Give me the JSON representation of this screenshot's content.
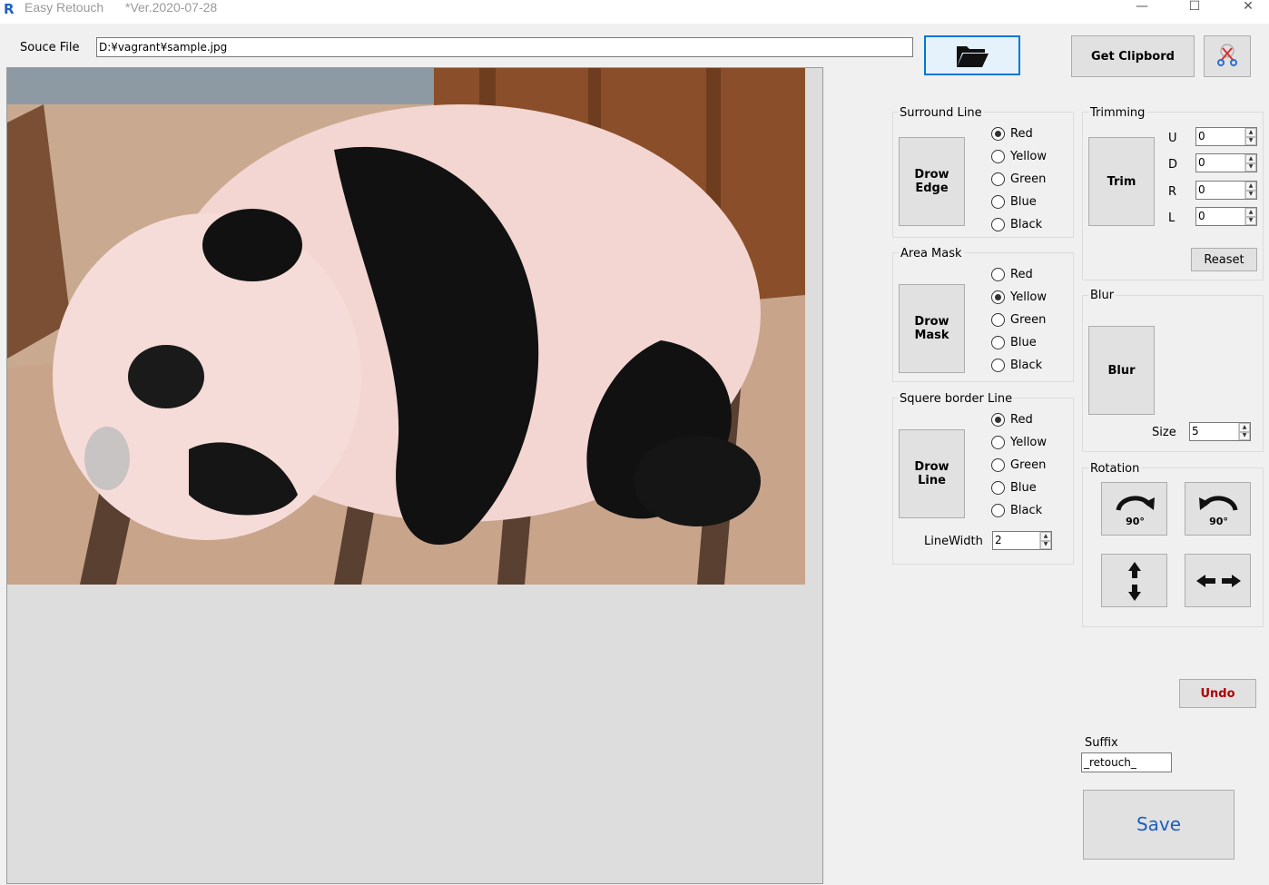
{
  "window": {
    "title": "Easy Retouch",
    "version": "*Ver.2020-07-28",
    "logo": "R",
    "minimize": "—",
    "maximize": "☐",
    "close": "✕"
  },
  "source": {
    "label": "Souce File",
    "path": "D:¥vagrant¥sample.jpg"
  },
  "toolbar": {
    "get_clipboard": "Get Clipbord"
  },
  "surround_line": {
    "title": "Surround Line",
    "button": [
      "Drow",
      "Edge"
    ],
    "options": [
      "Red",
      "Yellow",
      "Green",
      "Blue",
      "Black"
    ],
    "selected": "Red"
  },
  "area_mask": {
    "title": "Area Mask",
    "button": [
      "Drow",
      "Mask"
    ],
    "options": [
      "Red",
      "Yellow",
      "Green",
      "Blue",
      "Black"
    ],
    "selected": "Yellow"
  },
  "square_border": {
    "title": "Squere border Line",
    "button": [
      "Drow",
      "Line"
    ],
    "options": [
      "Red",
      "Yellow",
      "Green",
      "Blue",
      "Black"
    ],
    "selected": "Red",
    "linewidth_label": "LineWidth",
    "linewidth_value": "2"
  },
  "trimming": {
    "title": "Trimming",
    "button": "Trim",
    "fields": [
      {
        "label": "U",
        "value": "0"
      },
      {
        "label": "D",
        "value": "0"
      },
      {
        "label": "R",
        "value": "0"
      },
      {
        "label": "L",
        "value": "0"
      }
    ],
    "reset": "Reaset"
  },
  "blur": {
    "title": "Blur",
    "button": "Blur",
    "size_label": "Size",
    "size_value": "5"
  },
  "rotation": {
    "title": "Rotation",
    "rotate_cw_label": "90°",
    "rotate_ccw_label": "90°"
  },
  "undo": "Undo",
  "suffix": {
    "label": "Suffix",
    "value": "_retouch_"
  },
  "save": "Save",
  "colors": {
    "undo_text": "#b00000",
    "save_text": "#1a5fc0",
    "folder_button_border": "#0078d7"
  }
}
